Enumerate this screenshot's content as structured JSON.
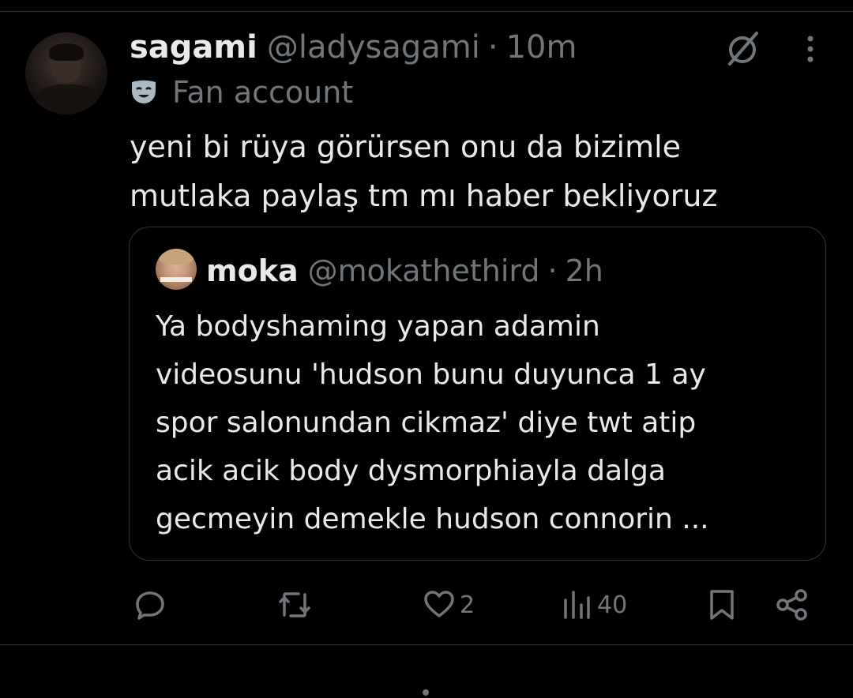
{
  "tweet": {
    "display_name": "sagami",
    "handle": "@ladysagami",
    "separator": "·",
    "time": "10m",
    "label": "Fan account",
    "text": "yeni bi rüya görürsen onu da bizimle\nmutlaka paylaş tm mı haber bekliyoruz"
  },
  "quote": {
    "display_name": "moka",
    "handle": "@mokathethird",
    "separator": "·",
    "time": "2h",
    "text": "Ya bodyshaming yapan adamin\nvideosunu 'hudson bunu duyunca 1 ay\nspor salonundan cikmaz' diye twt atip\nacik acik body dysmorphiayla dalga\ngecmeyin demekle hudson connorin ..."
  },
  "actions": {
    "reply_icon": "reply-icon",
    "retweet_icon": "retweet-icon",
    "like_icon": "heart-icon",
    "like_count": "2",
    "views_icon": "views-icon",
    "views_count": "40",
    "bookmark_icon": "bookmark-icon",
    "share_icon": "share-icon"
  },
  "colors": {
    "background": "#000000",
    "primary_text": "#e7e9ea",
    "secondary_text": "#71767b",
    "border": "#2f3336"
  }
}
